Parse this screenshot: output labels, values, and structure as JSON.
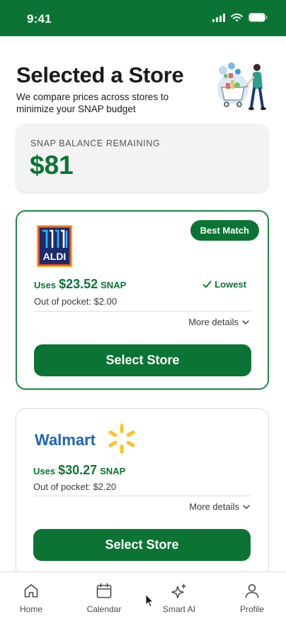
{
  "status_bar": {
    "time": "9:41",
    "icons": [
      "signal-icon",
      "wifi-icon",
      "battery-icon"
    ]
  },
  "header": {
    "title": "Selected a Store",
    "subtitle": "We compare prices across stores to minimize your SNAP budget",
    "illustration": "shopping-cart-illustration"
  },
  "balance": {
    "label": "SNAP BALANCE REMAINING",
    "value": "$81"
  },
  "stores": [
    {
      "name": "ALDI",
      "badge": "Best Match",
      "uses_prefix": "Uses",
      "amount": "$23.52",
      "uses_suffix": "SNAP",
      "out_of_pocket": "Out of pocket: $2.00",
      "tag": "Lowest",
      "details": "More details",
      "button": "Select Store"
    },
    {
      "name": "Walmart",
      "uses_prefix": "Uses",
      "amount": "$30.27",
      "uses_suffix": "SNAP",
      "out_of_pocket": "Out of pocket: $2.20",
      "details": "More details",
      "button": "Select Store"
    }
  ],
  "nav": [
    {
      "label": "Home",
      "icon": "home-icon"
    },
    {
      "label": "Calendar",
      "icon": "calendar-icon"
    },
    {
      "label": "Smart AI",
      "icon": "sparkle-icon"
    },
    {
      "label": "Profile",
      "icon": "profile-icon"
    }
  ],
  "colors": {
    "brand_green": "#0b7434",
    "card_border": "#1d8a45",
    "card_bg": "#f3f3f3"
  }
}
